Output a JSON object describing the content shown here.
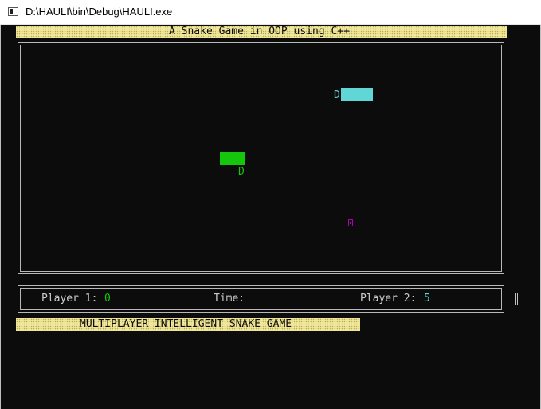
{
  "window": {
    "title": "D:\\HAULI\\bin\\Debug\\HAULI.exe",
    "icon": "console-app-icon"
  },
  "console": {
    "background": "#0c0c0c",
    "header_banner": "A Snake Game in OOP using C++",
    "footer_banner": "MULTIPLAYER INTELLIGENT SNAKE GAME",
    "banner_color": "#f1e79a"
  },
  "game": {
    "player1_snake": {
      "color": "#16c60c",
      "head_char": "D"
    },
    "player2_snake": {
      "color": "#61d6d6",
      "head_char": "D"
    },
    "food": {
      "color": "#b000b0",
      "icon": "food-icon"
    }
  },
  "status": {
    "player1_label": "Player 1:",
    "player1_score": "0",
    "time_label": "Time:",
    "player2_label": "Player 2:",
    "player2_score": "5"
  }
}
